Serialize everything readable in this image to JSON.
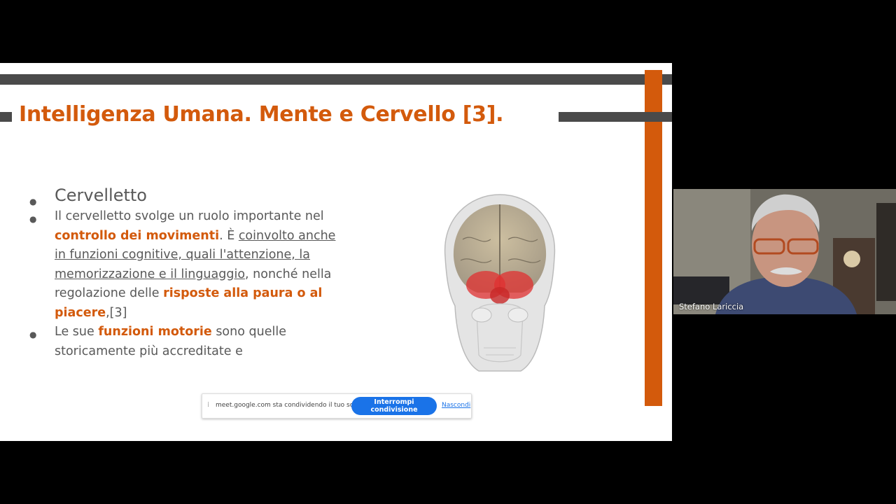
{
  "slide": {
    "title": "Intelligenza Umana. Mente e Cervello [3].",
    "bullet1": "Cervelletto",
    "bullet2": {
      "t1": "Il cervelletto svolge un ruolo importante nel ",
      "h1": "controllo dei movimenti",
      "t2": ". È ",
      "u1": "coinvolto anche in funzioni cognitive, quali l'attenzione, la memorizzazione e il linguaggio",
      "t3": ", nonché nella regolazione delle ",
      "h2": "risposte alla paura o al piacere",
      "t4": ",[3]"
    },
    "bullet3": {
      "t1": "Le sue ",
      "h1": "funzioni motorie",
      "t2": " sono quelle storicamente più accreditate e"
    },
    "colors": {
      "accent": "#d35a0c",
      "bar": "#4a4a4a",
      "text": "#595959"
    }
  },
  "share_bar": {
    "grip": "⁞",
    "text": "meet.google.com sta condividendo il tuo schermo.",
    "stop_label": "Interrompi condivisione",
    "hide_label": "Nascondi",
    "accent": "#1a73e8"
  },
  "participant": {
    "name": "Stefano Lariccia"
  }
}
